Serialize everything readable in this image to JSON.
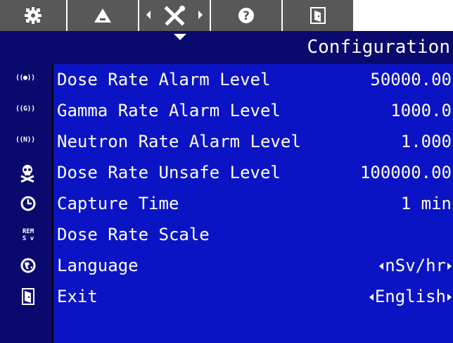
{
  "tabs": [
    {
      "icon": "gear-icon",
      "active": false
    },
    {
      "icon": "alarm-triangle-icon",
      "active": false
    },
    {
      "icon": "tools-icon",
      "active": true
    },
    {
      "icon": "help-icon",
      "active": false
    },
    {
      "icon": "exit-tab-icon",
      "active": false
    }
  ],
  "header": {
    "title": "Configuration"
  },
  "rows": [
    {
      "icon": "dose-rate-alarm-icon",
      "icon_text": "((●))",
      "label": "Dose Rate Alarm Level",
      "value": "50000.00"
    },
    {
      "icon": "gamma-rate-alarm-icon",
      "icon_text": "((G))",
      "label": "Gamma Rate Alarm Level",
      "value": "1000.0"
    },
    {
      "icon": "neutron-rate-alarm-icon",
      "icon_text": "((N))",
      "label": "Neutron Rate Alarm Level",
      "value": "1.000"
    },
    {
      "icon": "skull-crossbones-icon",
      "label": "Dose Rate Unsafe Level",
      "value": "100000.00"
    },
    {
      "icon": "clock-icon",
      "label": "Capture Time",
      "value": "1 min"
    },
    {
      "icon": "rem-sv-icon",
      "label": "Dose Rate Scale",
      "value": "nSv/hr"
    },
    {
      "icon": "globe-icon",
      "label": "Language",
      "value": "English"
    },
    {
      "icon": "exit-door-icon",
      "label": "Exit",
      "value": ""
    }
  ],
  "colors": {
    "background": "#0b14c4",
    "header_band": "#0a0a6e",
    "tab_bg": "#585858",
    "text": "#ffffff"
  }
}
